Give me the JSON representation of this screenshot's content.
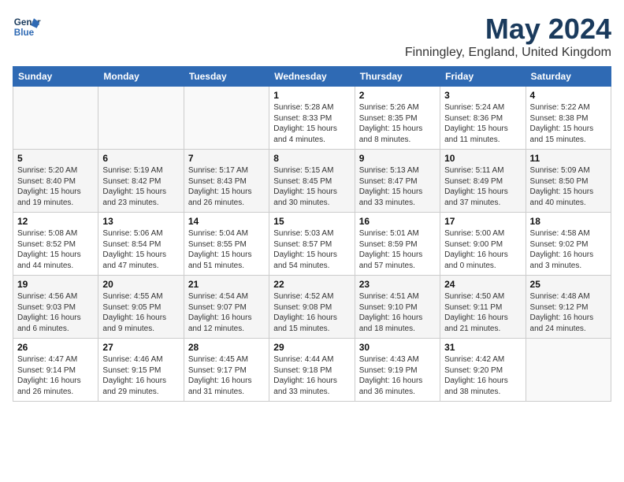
{
  "header": {
    "logo_line1": "General",
    "logo_line2": "Blue",
    "title": "May 2024",
    "subtitle": "Finningley, England, United Kingdom"
  },
  "weekdays": [
    "Sunday",
    "Monday",
    "Tuesday",
    "Wednesday",
    "Thursday",
    "Friday",
    "Saturday"
  ],
  "weeks": [
    [
      {
        "day": "",
        "info": ""
      },
      {
        "day": "",
        "info": ""
      },
      {
        "day": "",
        "info": ""
      },
      {
        "day": "1",
        "info": "Sunrise: 5:28 AM\nSunset: 8:33 PM\nDaylight: 15 hours\nand 4 minutes."
      },
      {
        "day": "2",
        "info": "Sunrise: 5:26 AM\nSunset: 8:35 PM\nDaylight: 15 hours\nand 8 minutes."
      },
      {
        "day": "3",
        "info": "Sunrise: 5:24 AM\nSunset: 8:36 PM\nDaylight: 15 hours\nand 11 minutes."
      },
      {
        "day": "4",
        "info": "Sunrise: 5:22 AM\nSunset: 8:38 PM\nDaylight: 15 hours\nand 15 minutes."
      }
    ],
    [
      {
        "day": "5",
        "info": "Sunrise: 5:20 AM\nSunset: 8:40 PM\nDaylight: 15 hours\nand 19 minutes."
      },
      {
        "day": "6",
        "info": "Sunrise: 5:19 AM\nSunset: 8:42 PM\nDaylight: 15 hours\nand 23 minutes."
      },
      {
        "day": "7",
        "info": "Sunrise: 5:17 AM\nSunset: 8:43 PM\nDaylight: 15 hours\nand 26 minutes."
      },
      {
        "day": "8",
        "info": "Sunrise: 5:15 AM\nSunset: 8:45 PM\nDaylight: 15 hours\nand 30 minutes."
      },
      {
        "day": "9",
        "info": "Sunrise: 5:13 AM\nSunset: 8:47 PM\nDaylight: 15 hours\nand 33 minutes."
      },
      {
        "day": "10",
        "info": "Sunrise: 5:11 AM\nSunset: 8:49 PM\nDaylight: 15 hours\nand 37 minutes."
      },
      {
        "day": "11",
        "info": "Sunrise: 5:09 AM\nSunset: 8:50 PM\nDaylight: 15 hours\nand 40 minutes."
      }
    ],
    [
      {
        "day": "12",
        "info": "Sunrise: 5:08 AM\nSunset: 8:52 PM\nDaylight: 15 hours\nand 44 minutes."
      },
      {
        "day": "13",
        "info": "Sunrise: 5:06 AM\nSunset: 8:54 PM\nDaylight: 15 hours\nand 47 minutes."
      },
      {
        "day": "14",
        "info": "Sunrise: 5:04 AM\nSunset: 8:55 PM\nDaylight: 15 hours\nand 51 minutes."
      },
      {
        "day": "15",
        "info": "Sunrise: 5:03 AM\nSunset: 8:57 PM\nDaylight: 15 hours\nand 54 minutes."
      },
      {
        "day": "16",
        "info": "Sunrise: 5:01 AM\nSunset: 8:59 PM\nDaylight: 15 hours\nand 57 minutes."
      },
      {
        "day": "17",
        "info": "Sunrise: 5:00 AM\nSunset: 9:00 PM\nDaylight: 16 hours\nand 0 minutes."
      },
      {
        "day": "18",
        "info": "Sunrise: 4:58 AM\nSunset: 9:02 PM\nDaylight: 16 hours\nand 3 minutes."
      }
    ],
    [
      {
        "day": "19",
        "info": "Sunrise: 4:56 AM\nSunset: 9:03 PM\nDaylight: 16 hours\nand 6 minutes."
      },
      {
        "day": "20",
        "info": "Sunrise: 4:55 AM\nSunset: 9:05 PM\nDaylight: 16 hours\nand 9 minutes."
      },
      {
        "day": "21",
        "info": "Sunrise: 4:54 AM\nSunset: 9:07 PM\nDaylight: 16 hours\nand 12 minutes."
      },
      {
        "day": "22",
        "info": "Sunrise: 4:52 AM\nSunset: 9:08 PM\nDaylight: 16 hours\nand 15 minutes."
      },
      {
        "day": "23",
        "info": "Sunrise: 4:51 AM\nSunset: 9:10 PM\nDaylight: 16 hours\nand 18 minutes."
      },
      {
        "day": "24",
        "info": "Sunrise: 4:50 AM\nSunset: 9:11 PM\nDaylight: 16 hours\nand 21 minutes."
      },
      {
        "day": "25",
        "info": "Sunrise: 4:48 AM\nSunset: 9:12 PM\nDaylight: 16 hours\nand 24 minutes."
      }
    ],
    [
      {
        "day": "26",
        "info": "Sunrise: 4:47 AM\nSunset: 9:14 PM\nDaylight: 16 hours\nand 26 minutes."
      },
      {
        "day": "27",
        "info": "Sunrise: 4:46 AM\nSunset: 9:15 PM\nDaylight: 16 hours\nand 29 minutes."
      },
      {
        "day": "28",
        "info": "Sunrise: 4:45 AM\nSunset: 9:17 PM\nDaylight: 16 hours\nand 31 minutes."
      },
      {
        "day": "29",
        "info": "Sunrise: 4:44 AM\nSunset: 9:18 PM\nDaylight: 16 hours\nand 33 minutes."
      },
      {
        "day": "30",
        "info": "Sunrise: 4:43 AM\nSunset: 9:19 PM\nDaylight: 16 hours\nand 36 minutes."
      },
      {
        "day": "31",
        "info": "Sunrise: 4:42 AM\nSunset: 9:20 PM\nDaylight: 16 hours\nand 38 minutes."
      },
      {
        "day": "",
        "info": ""
      }
    ]
  ]
}
